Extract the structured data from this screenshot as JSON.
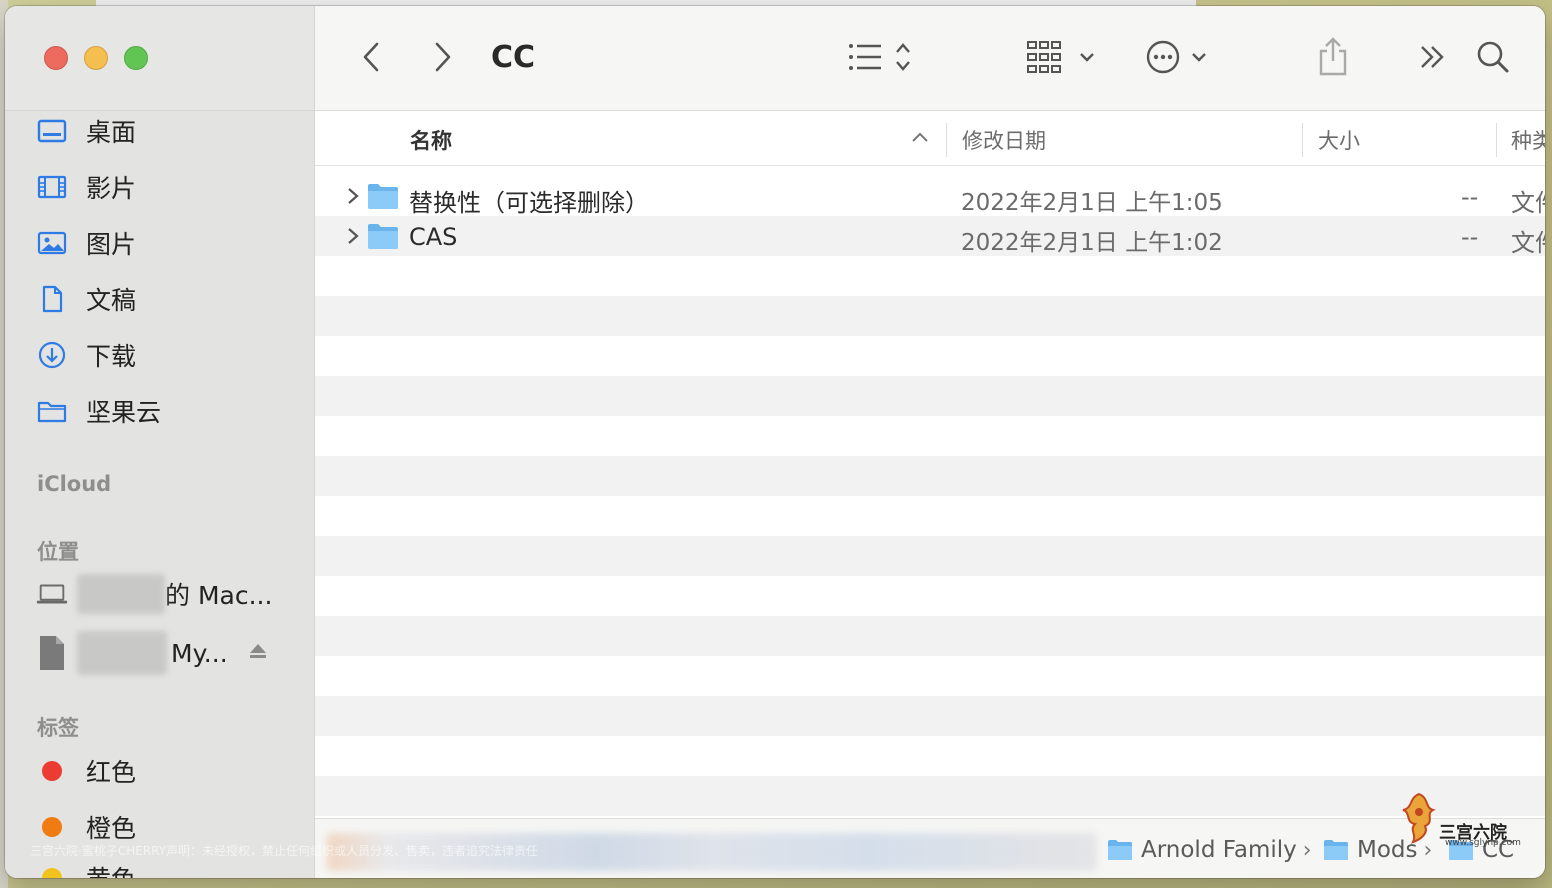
{
  "window": {
    "title": "CC"
  },
  "sidebar": {
    "favorites": [
      {
        "label": "桌面",
        "icon": "desktop-icon"
      },
      {
        "label": "影片",
        "icon": "film-icon"
      },
      {
        "label": "图片",
        "icon": "photo-icon"
      },
      {
        "label": "文稿",
        "icon": "document-icon"
      },
      {
        "label": "下载",
        "icon": "download-icon"
      },
      {
        "label": "坚果云",
        "icon": "folder-icon"
      }
    ],
    "icloud_header": "iCloud",
    "locations_header": "位置",
    "locations": [
      {
        "label": "的 Mac...",
        "icon": "laptop-icon"
      },
      {
        "label": "My...",
        "icon": "disk-icon"
      }
    ],
    "tags_header": "标签",
    "tags": [
      {
        "label": "红色",
        "color": "#ec3b32"
      },
      {
        "label": "橙色",
        "color": "#ef7b11"
      },
      {
        "label": "黄色",
        "color": "#f2c21d"
      }
    ]
  },
  "columns": {
    "name": "名称",
    "modified": "修改日期",
    "size": "大小",
    "kind": "种类"
  },
  "files": [
    {
      "name": "替换性（可选择删除）",
      "modified": "2022年2月1日 上午1:05",
      "size": "--",
      "kind": "文件夹"
    },
    {
      "name": "CAS",
      "modified": "2022年2月1日 上午1:02",
      "size": "--",
      "kind": "文件夹"
    }
  ],
  "pathbar": {
    "crumbs": [
      "Arnold Family",
      "Mods",
      "CC"
    ]
  },
  "watermark": {
    "notice": "三宫六院·蜜桃子CHERRY声明：未经授权，禁止任何组织或人员分发、售卖，违者追究法律责任",
    "logo_text": "三宫六院",
    "logo_url": "www.sglynp.com"
  }
}
